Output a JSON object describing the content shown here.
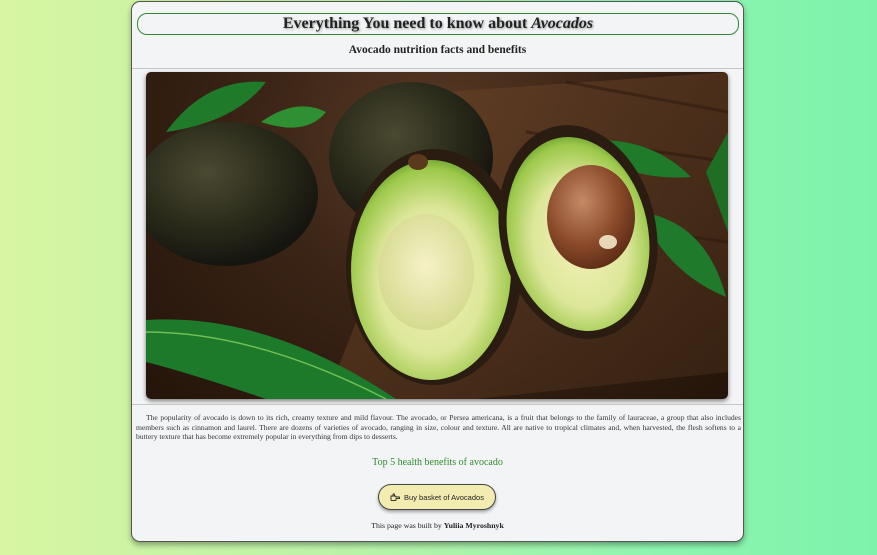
{
  "header": {
    "title_prefix": "Everything You need to know about",
    "title_emphasis": "Avocados",
    "subtitle": "Avocado nutrition facts and benefits"
  },
  "image": {
    "alt": "Avocados"
  },
  "article": {
    "paragraph": "The popularity of avocado is down to its rich, creamy texture and mild flavour. The avocado, or Persea americana, is a fruit that belongs to the family of lauraceae, a group that also includes members such as cinnamon and laurel. There are dozens of varieties of avocado, ranging in size, colour and texture. All are native to tropical climates and, when harvested, the flesh softens to a buttery texture that has become extremely popular in everything from dips to desserts."
  },
  "links": {
    "benefits": "Top 5 health benefits of avocado"
  },
  "actions": {
    "buy_label": "Buy basket of Avocados",
    "buy_icon": "hand-pointing-icon"
  },
  "footer": {
    "prefix": "This page was built by",
    "author": "Yuliia Myroshnyk"
  },
  "colors": {
    "accent_green": "#2e8b2e",
    "button_bg": "#f2ecb0"
  }
}
